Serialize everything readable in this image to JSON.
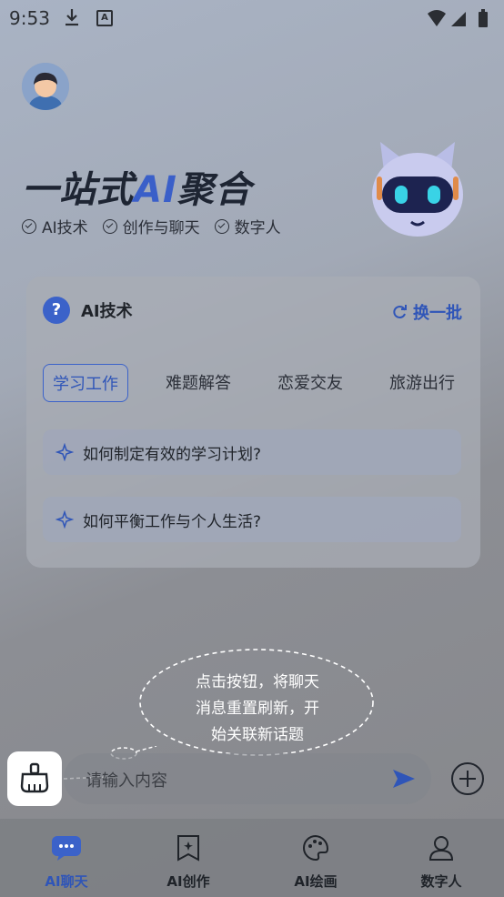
{
  "status": {
    "time": "9:53",
    "a_badge": "A"
  },
  "hero": {
    "title_left": "一站式",
    "title_ai": "AI",
    "title_right": "聚合",
    "tags": [
      "AI技术",
      "创作与聊天",
      "数字人"
    ]
  },
  "card": {
    "title": "AI技术",
    "refresh_label": "换一批",
    "question_icon": "?",
    "tabs": [
      "学习工作",
      "难题解答",
      "恋爱交友",
      "旅游出行"
    ],
    "questions": [
      "如何制定有效的学习计划?",
      "如何平衡工作与个人生活?"
    ]
  },
  "tooltip": {
    "lines": [
      "点击按钮，将聊天",
      "消息重置刷新，开",
      "始关联新话题"
    ]
  },
  "input": {
    "placeholder": "请输入内容"
  },
  "nav": {
    "items": [
      "AI聊天",
      "AI创作",
      "AI绘画",
      "数字人"
    ],
    "active_index": 0
  },
  "colors": {
    "accent": "#3b62c9",
    "text": "#1f2329"
  },
  "icons": [
    "download-icon",
    "a-icon",
    "wifi-icon",
    "signal-icon",
    "battery-icon",
    "avatar",
    "robot-mascot",
    "question-icon",
    "refresh-icon",
    "sparkle-icon",
    "broom-icon",
    "send-icon",
    "plus-icon",
    "chat-icon",
    "create-icon",
    "paint-icon",
    "person-icon"
  ]
}
